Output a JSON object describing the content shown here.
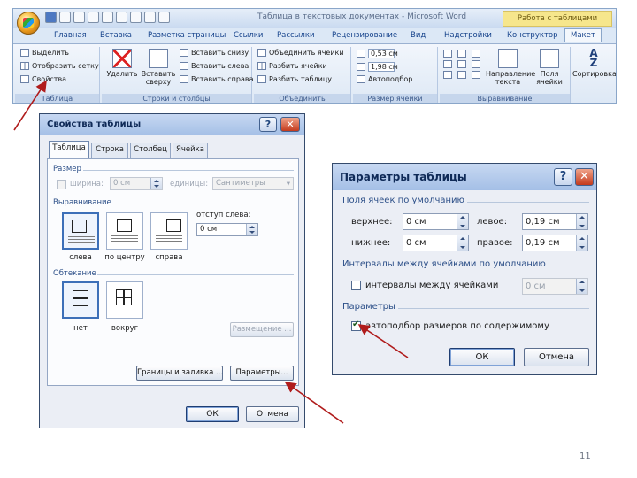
{
  "ribbon": {
    "title": "Таблица в текстовых документах - Microsoft Word",
    "context_title": "Работа с таблицами",
    "tabs": [
      "Главная",
      "Вставка",
      "Разметка страницы",
      "Ссылки",
      "Рассылки",
      "Рецензирование",
      "Вид",
      "Надстройки",
      "Конструктор",
      "Макет"
    ],
    "active_tab": "Макет",
    "groups": {
      "table": {
        "label": "Таблица",
        "items": [
          "Выделить",
          "Отобразить сетку",
          "Свойства"
        ]
      },
      "rows_cols": {
        "label": "Строки и столбцы",
        "delete_label": "Удалить",
        "insert_above_label": "Вставить сверху",
        "items": [
          "Вставить снизу",
          "Вставить слева",
          "Вставить справа"
        ]
      },
      "merge": {
        "label": "Объединить",
        "items": [
          "Объединить ячейки",
          "Разбить ячейки",
          "Разбить таблицу"
        ]
      },
      "cell_size": {
        "label": "Размер ячейки",
        "height": "0,53 см",
        "width": "1,98 см",
        "autofit": "Автоподбор"
      },
      "alignment": {
        "label": "Выравнивание",
        "direction_label": "Направление текста",
        "margins_label": "Поля ячейки"
      },
      "sort_label": "Сортировка"
    }
  },
  "table_props": {
    "title": "Свойства таблицы",
    "help": "?",
    "close": "✕",
    "tabs": [
      "Таблица",
      "Строка",
      "Столбец",
      "Ячейка"
    ],
    "size_section": "Размер",
    "width_label": "ширина:",
    "width_value": "0 см",
    "units_label": "единицы:",
    "units_value": "Сантиметры",
    "alignment_section": "Выравнивание",
    "indent_label": "отступ слева:",
    "indent_value": "0 см",
    "alignment_options": [
      "слева",
      "по центру",
      "справа"
    ],
    "wrap_section": "Обтекание",
    "wrap_options": [
      "нет",
      "вокруг"
    ],
    "placement_button": "Размещение ...",
    "borders_button": "Границы и заливка ...",
    "options_button": "Параметры...",
    "ok": "ОК",
    "cancel": "Отмена"
  },
  "table_options": {
    "title": "Параметры таблицы",
    "help": "?",
    "close": "✕",
    "margins_section": "Поля ячеек по умолчанию",
    "top_label": "верхнее:",
    "top_value": "0 см",
    "left_label": "левое:",
    "left_value": "0,19 см",
    "bottom_label": "нижнее:",
    "bottom_value": "0 см",
    "right_label": "правое:",
    "right_value": "0,19 см",
    "spacing_section": "Интервалы между ячейками по умолчанию",
    "spacing_checkbox": "интервалы между ячейками",
    "spacing_value": "0 см",
    "params_section": "Параметры",
    "autofit_checkbox": "автоподбор размеров по содержимому",
    "ok": "ОК",
    "cancel": "Отмена"
  },
  "slide_number": "11"
}
